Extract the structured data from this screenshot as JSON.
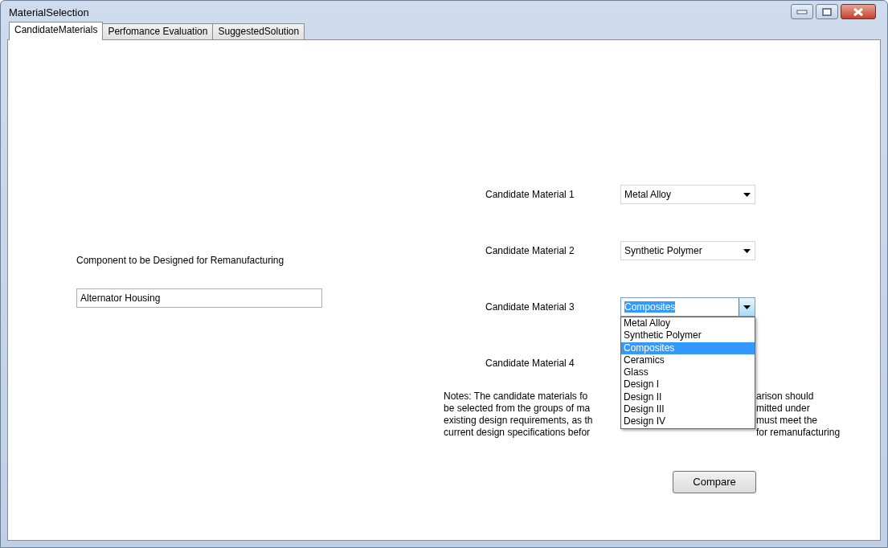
{
  "window": {
    "title": "MaterialSelection"
  },
  "tabs": [
    {
      "label": "CandidateMaterials",
      "selected": true
    },
    {
      "label": "Perfomance Evaluation",
      "selected": false
    },
    {
      "label": "SuggestedSolution",
      "selected": false
    }
  ],
  "component": {
    "label": "Component to be Designed for Remanufacturing",
    "value": "Alternator Housing"
  },
  "candidates": [
    {
      "label": "Candidate Material 1",
      "value": "Metal Alloy",
      "open": false
    },
    {
      "label": "Candidate Material 2",
      "value": "Synthetic Polymer",
      "open": false
    },
    {
      "label": "Candidate Material 3",
      "value": "Composites",
      "open": true
    },
    {
      "label": "Candidate Material 4"
    }
  ],
  "dropdown_options": [
    {
      "label": "Metal Alloy",
      "selected": false
    },
    {
      "label": "Synthetic Polymer",
      "selected": false
    },
    {
      "label": "Composites",
      "selected": true
    },
    {
      "label": "Ceramics",
      "selected": false
    },
    {
      "label": "Glass",
      "selected": false
    },
    {
      "label": "Design I",
      "selected": false
    },
    {
      "label": "Design II",
      "selected": false
    },
    {
      "label": "Design III",
      "selected": false
    },
    {
      "label": "Design IV",
      "selected": false
    }
  ],
  "notes": [
    {
      "left": "Notes: The candidate materials fo",
      "right": "arison should"
    },
    {
      "left": "be selected from the groups of ma",
      "right": "mitted under"
    },
    {
      "left": "existing design requirements, as th",
      "right": "must meet the"
    },
    {
      "left": "current design specifications befor",
      "right": "for remanufacturing"
    }
  ],
  "compare_button": "Compare"
}
